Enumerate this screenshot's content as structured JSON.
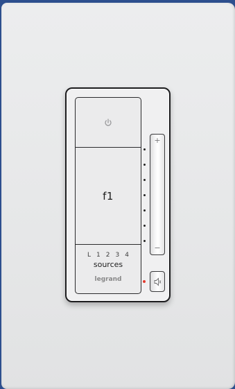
{
  "device": {
    "power_icon": "power-icon",
    "f1_label": "f1",
    "source_numbers": [
      "L",
      "1",
      "2",
      "3",
      "4"
    ],
    "sources_label": "sources",
    "brand": "legrand",
    "volume_plus": "+",
    "volume_minus": "−",
    "mute_icon": "speaker-icon",
    "mute_led_color": "#e23b2e",
    "level_indicator_count": 7
  }
}
